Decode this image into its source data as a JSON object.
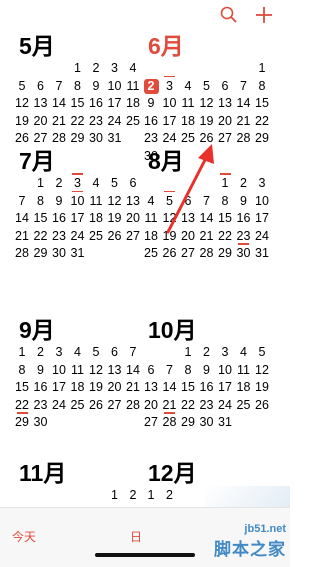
{
  "colors": {
    "accent": "#e04b3c",
    "text": "#000000",
    "watermark": "#2e7fc0"
  },
  "toolbar": {
    "search_icon": "search-icon",
    "add_icon": "plus-icon"
  },
  "months": [
    {
      "title": "5月",
      "rows": [
        [
          "",
          "",
          "",
          "1",
          "2",
          "3",
          "4"
        ],
        [
          "5",
          "6",
          "7",
          "8",
          "9",
          "10",
          "11"
        ],
        [
          "12",
          "13",
          "14",
          "15",
          "16",
          "17",
          "18"
        ],
        [
          "19",
          "20",
          "21",
          "22",
          "23",
          "24",
          "25"
        ],
        [
          "26",
          "27",
          "28",
          "29",
          "30",
          "31",
          ""
        ]
      ],
      "underlined": [],
      "today": ""
    },
    {
      "title": "6月",
      "rows": [
        [
          "",
          "",
          "",
          "",
          "",
          "",
          "1"
        ],
        [
          "2",
          "3",
          "4",
          "5",
          "6",
          "7",
          "8"
        ],
        [
          "9",
          "10",
          "11",
          "12",
          "13",
          "14",
          "15"
        ],
        [
          "16",
          "17",
          "18",
          "19",
          "20",
          "21",
          "22"
        ],
        [
          "23",
          "24",
          "25",
          "26",
          "27",
          "28",
          "29"
        ],
        [
          "30",
          "",
          "",
          "",
          "",
          "",
          ""
        ]
      ],
      "underlined": [
        "3"
      ],
      "today": "2"
    },
    {
      "title": "7月",
      "rows": [
        [
          "",
          "1",
          "2",
          "3",
          "4",
          "5",
          "6"
        ],
        [
          "7",
          "8",
          "9",
          "10",
          "11",
          "12",
          "13"
        ],
        [
          "14",
          "15",
          "16",
          "17",
          "18",
          "19",
          "20"
        ],
        [
          "21",
          "22",
          "23",
          "24",
          "25",
          "26",
          "27"
        ],
        [
          "28",
          "29",
          "30",
          "31",
          "",
          "",
          ""
        ]
      ],
      "underlined": [
        "3",
        "10"
      ],
      "today": ""
    },
    {
      "title": "8月",
      "rows": [
        [
          "",
          "",
          "",
          "",
          "1",
          "2",
          "3"
        ],
        [
          "4",
          "5",
          "6",
          "7",
          "8",
          "9",
          "10"
        ],
        [
          "11",
          "12",
          "13",
          "14",
          "15",
          "16",
          "17"
        ],
        [
          "18",
          "19",
          "20",
          "21",
          "22",
          "23",
          "24"
        ],
        [
          "25",
          "26",
          "27",
          "28",
          "29",
          "30",
          "31"
        ]
      ],
      "underlined": [
        "5",
        "1",
        "30"
      ],
      "today": ""
    },
    {
      "title": "9月",
      "rows": [
        [
          "1",
          "2",
          "3",
          "4",
          "5",
          "6",
          "7"
        ],
        [
          "8",
          "9",
          "10",
          "11",
          "12",
          "13",
          "14"
        ],
        [
          "15",
          "16",
          "17",
          "18",
          "19",
          "20",
          "21"
        ],
        [
          "22",
          "23",
          "24",
          "25",
          "26",
          "27",
          "28"
        ],
        [
          "29",
          "30",
          "",
          "",
          "",
          "",
          ""
        ]
      ],
      "underlined": [
        "29"
      ],
      "today": ""
    },
    {
      "title": "10月",
      "rows": [
        [
          "",
          "",
          "1",
          "2",
          "3",
          "4",
          "5"
        ],
        [
          "6",
          "7",
          "8",
          "9",
          "10",
          "11",
          "12"
        ],
        [
          "13",
          "14",
          "15",
          "16",
          "17",
          "18",
          "19"
        ],
        [
          "20",
          "21",
          "22",
          "23",
          "24",
          "25",
          "26"
        ],
        [
          "27",
          "28",
          "29",
          "30",
          "31",
          "",
          ""
        ]
      ],
      "underlined": [
        "28"
      ],
      "today": ""
    },
    {
      "title": "11月",
      "rows": [
        [
          "",
          "",
          "",
          "",
          "",
          "1",
          "2"
        ]
      ],
      "underlined": [],
      "today": ""
    },
    {
      "title": "12月",
      "rows": [
        [
          "1",
          "2",
          "",
          "",
          "",
          "",
          ""
        ]
      ],
      "underlined": [],
      "today": ""
    }
  ],
  "bottom": {
    "today_label": "今天",
    "calendars_label": "日"
  },
  "watermark": {
    "line1": "jb51.net",
    "line2": "脚本之家"
  }
}
